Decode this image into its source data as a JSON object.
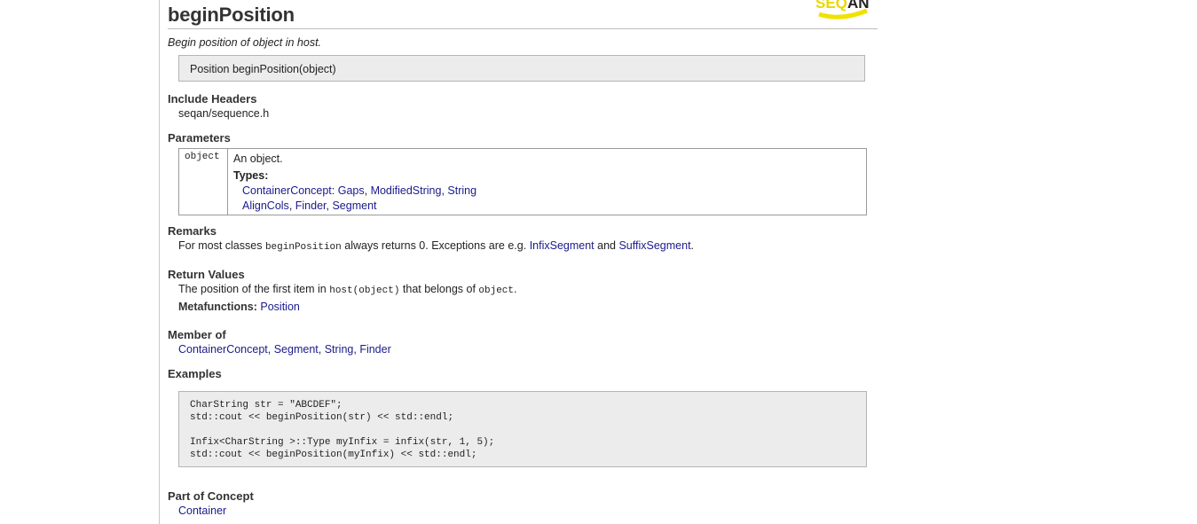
{
  "page": {
    "title": "beginPosition",
    "summary": "Begin position of object in host.",
    "logo_text": "SEQAN"
  },
  "signature": "Position beginPosition(object)",
  "include_headers": {
    "heading": "Include Headers",
    "value": "seqan/sequence.h"
  },
  "parameters": {
    "heading": "Parameters",
    "rows": [
      {
        "name": "object",
        "description": "An object.",
        "types_label": "Types:",
        "types_line1": [
          {
            "text": "ContainerConcept",
            "link": true
          },
          {
            "text": ": ",
            "link": false
          },
          {
            "text": "Gaps",
            "link": true
          },
          {
            "text": ", ",
            "link": false
          },
          {
            "text": "ModifiedString",
            "link": true
          },
          {
            "text": ", ",
            "link": false
          },
          {
            "text": "String",
            "link": true
          }
        ],
        "types_line2": [
          {
            "text": "AlignCols",
            "link": true
          },
          {
            "text": ", ",
            "link": false
          },
          {
            "text": "Finder",
            "link": true
          },
          {
            "text": ", ",
            "link": false
          },
          {
            "text": "Segment",
            "link": true
          }
        ]
      }
    ]
  },
  "remarks": {
    "heading": "Remarks",
    "pre": "For most classes ",
    "code": "beginPosition",
    "mid": " always returns 0. Exceptions are e.g. ",
    "link1": "InfixSegment",
    "and": " and ",
    "link2": "SuffixSegment",
    "end": "."
  },
  "return_values": {
    "heading": "Return Values",
    "pre": "The position of the first item in ",
    "code1": "host(object)",
    "mid": " that belongs of ",
    "code2": "object",
    "end": ".",
    "meta_label": "Metafunctions:",
    "meta_link": "Position"
  },
  "member_of": {
    "heading": "Member of",
    "items": [
      "ContainerConcept",
      "Segment",
      "String",
      "Finder"
    ]
  },
  "examples": {
    "heading": "Examples",
    "code": "CharString str = \"ABCDEF\";\nstd::cout << beginPosition(str) << std::endl;\n\nInfix<CharString >::Type myInfix = infix(str, 1, 5);\nstd::cout << beginPosition(myInfix) << std::endl;"
  },
  "part_of_concept": {
    "heading": "Part of Concept",
    "link": "Container"
  },
  "colors": {
    "link": "#1a1a8c",
    "box_bg": "#ececec",
    "logo_yellow": "#f2e100"
  }
}
